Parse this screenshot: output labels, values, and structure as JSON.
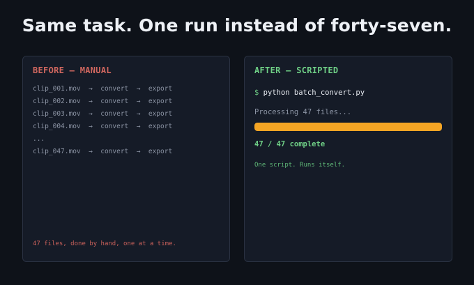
{
  "headline": "Same task. One run instead of forty-seven.",
  "before": {
    "heading": "BEFORE — MANUAL",
    "steps": [
      "clip_001.mov  →  convert  →  export",
      "clip_002.mov  →  convert  →  export",
      "clip_003.mov  →  convert  →  export",
      "clip_004.mov  →  convert  →  export",
      "...",
      "clip_047.mov  →  convert  →  export"
    ],
    "footnote": "47 files, done by hand, one at a time."
  },
  "after": {
    "heading": "AFTER — SCRIPTED",
    "prompt": "$",
    "command": "python batch_convert.py",
    "status": "Processing 47 files...",
    "progress_fraction": 1.0,
    "progress_color": "#f5a524",
    "complete": "47 / 47 complete",
    "footnote": "One script. Runs itself."
  },
  "colors": {
    "background": "#0e1219",
    "panel": "#151b27",
    "before_accent": "#d0675f",
    "after_accent": "#6fcf86"
  }
}
